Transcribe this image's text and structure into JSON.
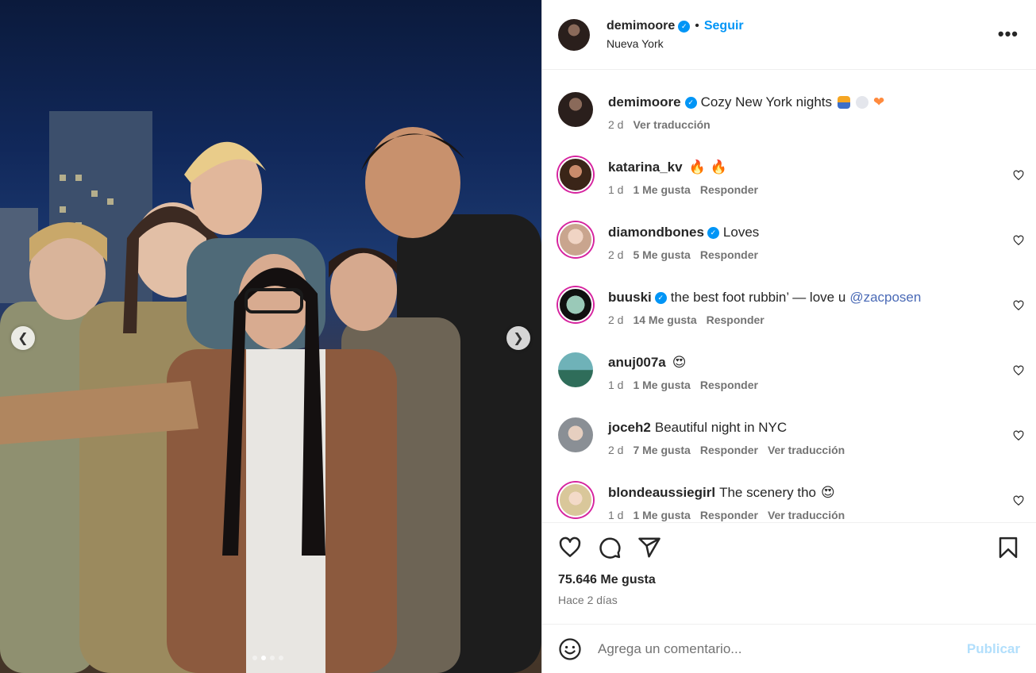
{
  "carousel": {
    "prev_icon": "chevron-left-icon",
    "next_icon": "chevron-right-icon",
    "slides": 4,
    "active_slide": 2
  },
  "post": {
    "author": "demimoore",
    "follow_label": "Seguir",
    "separator": "•",
    "location": "Nueva York",
    "more_label": "•••",
    "caption": {
      "username": "demimoore",
      "text": "Cozy New York nights",
      "age": "2 d",
      "translate": "Ver traducción"
    }
  },
  "comments": [
    {
      "username": "katarina_kv",
      "verified": false,
      "text": "",
      "age": "1 d",
      "likes": "1 Me gusta",
      "reply": "Responder",
      "translate": ""
    },
    {
      "username": "diamondbones",
      "verified": true,
      "text": "Loves",
      "age": "2 d",
      "likes": "5 Me gusta",
      "reply": "Responder",
      "translate": ""
    },
    {
      "username": "buuski",
      "verified": true,
      "text": "the best foot rubbin’ — love u",
      "mention": "@zacposen",
      "age": "2 d",
      "likes": "14 Me gusta",
      "reply": "Responder",
      "translate": ""
    },
    {
      "username": "anuj007a",
      "verified": false,
      "text": "",
      "age": "1 d",
      "likes": "1 Me gusta",
      "reply": "Responder",
      "translate": ""
    },
    {
      "username": "joceh2",
      "verified": false,
      "text": "Beautiful night in NYC",
      "age": "2 d",
      "likes": "7 Me gusta",
      "reply": "Responder",
      "translate": "Ver traducción"
    },
    {
      "username": "blondeaussiegirl",
      "verified": false,
      "text": "The scenery tho",
      "age": "1 d",
      "likes": "1 Me gusta",
      "reply": "Responder",
      "translate": "Ver traducción"
    }
  ],
  "stats": {
    "likes": "75.646 Me gusta",
    "time_ago": "Hace 2 días"
  },
  "composer": {
    "placeholder": "Agrega un comentario...",
    "publish_label": "Publicar"
  },
  "colors": {
    "accent": "#0095f6",
    "mention": "#4a6ab6",
    "muted": "#737373",
    "story_ring": "#d6249f"
  }
}
